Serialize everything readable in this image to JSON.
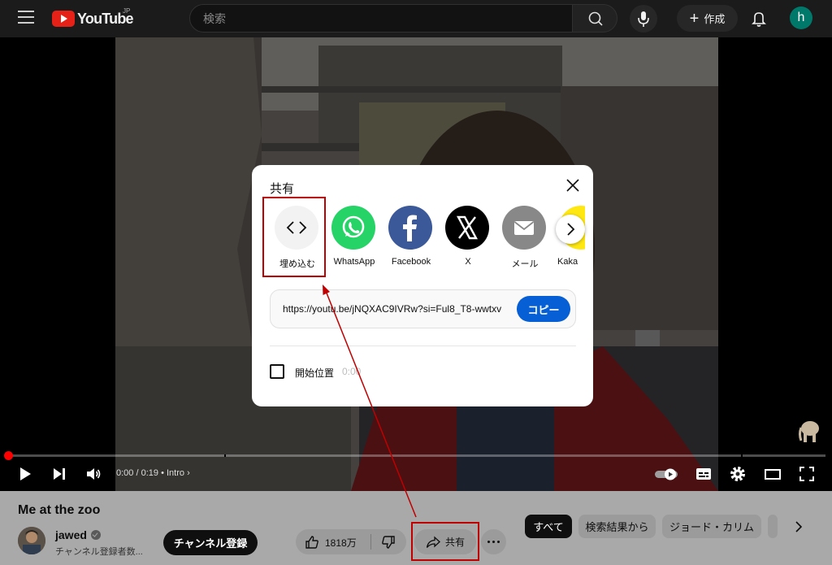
{
  "header": {
    "logo_text": "YouTube",
    "logo_region": "JP",
    "search_placeholder": "検索",
    "create_label": "作成",
    "avatar_letter": "h"
  },
  "player": {
    "time": "0:00 / 0:19",
    "chapter": "Intro",
    "progress_fraction": 0.0
  },
  "video": {
    "title": "Me at the zoo",
    "channel_name": "jawed",
    "channel_subs": "チャンネル登録者数...",
    "subscribe_label": "チャンネル登録",
    "like_count": "1818万",
    "share_label": "共有"
  },
  "chips": [
    {
      "label": "すべて",
      "active": true
    },
    {
      "label": "検索結果から",
      "active": false
    },
    {
      "label": "ジョード・カリム",
      "active": false
    }
  ],
  "share_dialog": {
    "title": "共有",
    "targets": [
      {
        "label": "埋め込む",
        "icon": "embed-code-icon",
        "color": "#f2f2f2"
      },
      {
        "label": "WhatsApp",
        "icon": "whatsapp-icon",
        "color": "#25d366"
      },
      {
        "label": "Facebook",
        "icon": "facebook-icon",
        "color": "#3b5998"
      },
      {
        "label": "X",
        "icon": "x-logo-icon",
        "color": "#000000"
      },
      {
        "label": "メール",
        "icon": "mail-icon",
        "color": "#888888"
      },
      {
        "label": "Kaka",
        "icon": "kakaotalk-icon",
        "color": "#ffe812"
      }
    ],
    "link_url": "https://youtu.be/jNQXAC9IVRw?si=Ful8_T8-wwtxv",
    "copy_label": "コピー",
    "start_at_label": "開始位置",
    "start_at_time": "0:00"
  },
  "colors": {
    "accent_red": "#ff0000",
    "annotation_red": "#c00000",
    "copy_blue": "#065fd4"
  }
}
